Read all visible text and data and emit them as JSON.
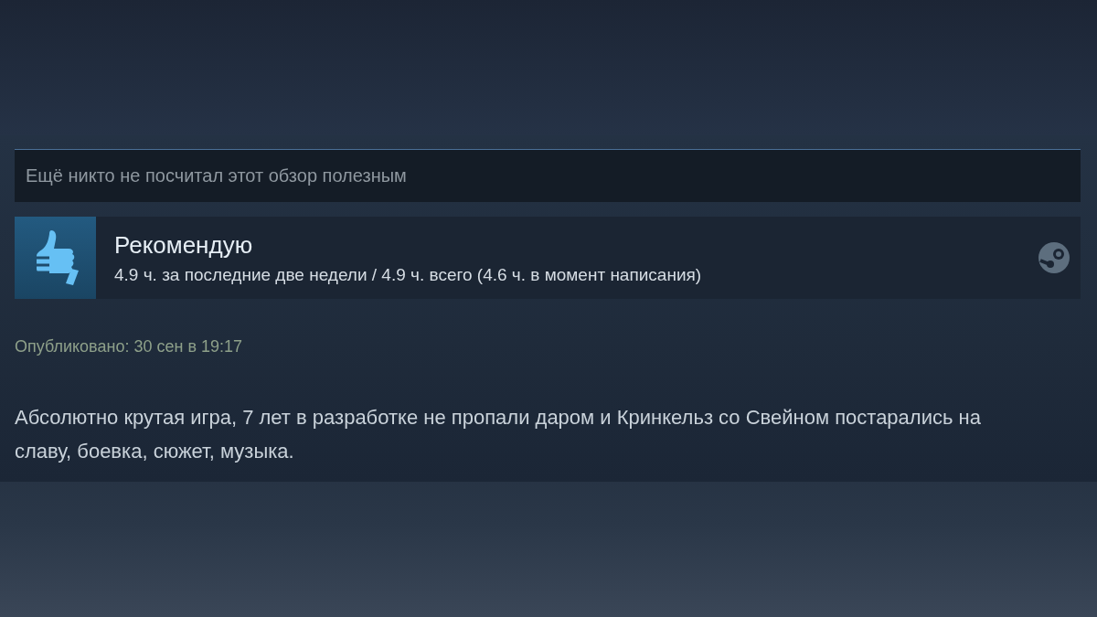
{
  "helpful_note": "Ещё никто не посчитал этот обзор полезным",
  "review": {
    "verdict": "Рекомендую",
    "recommended": true,
    "hours": "4.9 ч. за последние две недели / 4.9 ч. всего (4.6 ч. в момент написания)"
  },
  "posted": "Опубликовано: 30 сен в 19:17",
  "body": "Абсолютно крутая игра, 7 лет в разработке не пропали даром и Кринкельз со Свейном постарались на славу, боевка, сюжет, музыка."
}
